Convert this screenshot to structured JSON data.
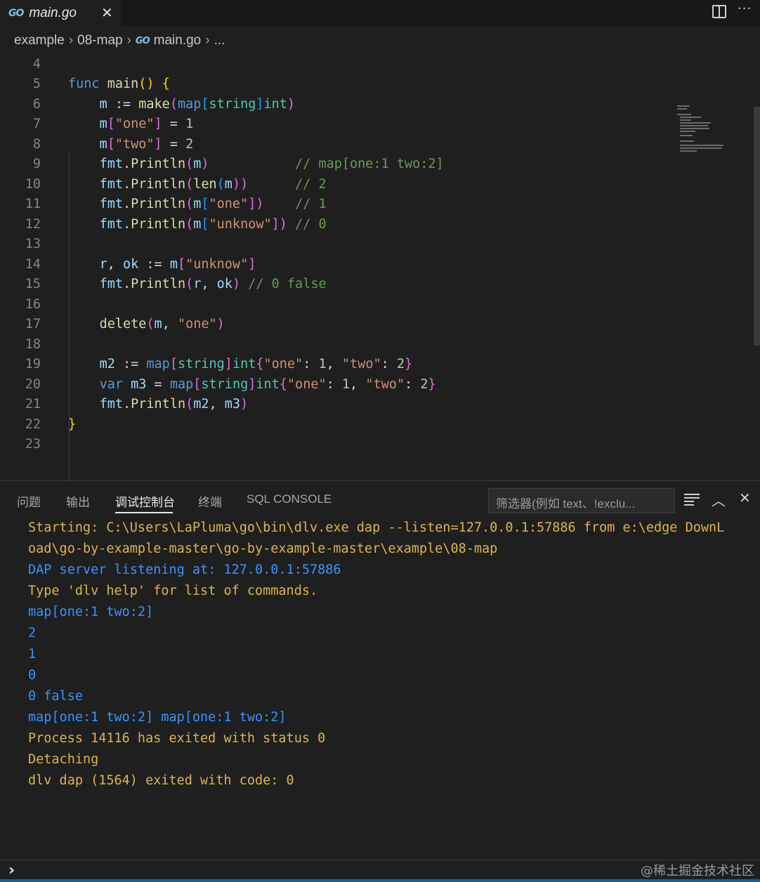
{
  "tab": {
    "icon": "go-logo-icon",
    "logo_text": "GO",
    "title": "main.go",
    "close": "✕"
  },
  "toolbar": {
    "split": "split-editor-icon",
    "more": "···"
  },
  "breadcrumb": {
    "parts": [
      "example",
      "08-map",
      "main.go",
      "..."
    ]
  },
  "editor": {
    "lines": [
      {
        "n": "4"
      },
      {
        "n": "5"
      },
      {
        "n": "6"
      },
      {
        "n": "7"
      },
      {
        "n": "8"
      },
      {
        "n": "9"
      },
      {
        "n": "10"
      },
      {
        "n": "11"
      },
      {
        "n": "12"
      },
      {
        "n": "13"
      },
      {
        "n": "14"
      },
      {
        "n": "15"
      },
      {
        "n": "16"
      },
      {
        "n": "17"
      },
      {
        "n": "18"
      },
      {
        "n": "19"
      },
      {
        "n": "20"
      },
      {
        "n": "21"
      },
      {
        "n": "22"
      },
      {
        "n": "23"
      }
    ],
    "code": {
      "l5": [
        "func",
        "main",
        "()",
        " {"
      ],
      "l6": [
        "m",
        ":=",
        "make",
        "(",
        "map",
        "[",
        "string",
        "]",
        "int",
        ")"
      ],
      "l7": [
        "m",
        "[",
        "\"one\"",
        "]",
        "=",
        "1"
      ],
      "l8": [
        "m",
        "[",
        "\"two\"",
        "]",
        "=",
        "2"
      ],
      "l9": [
        "fmt",
        ".",
        "Println",
        "(",
        "m",
        ")",
        "// map[one:1 two:2]"
      ],
      "l10": [
        "fmt",
        ".",
        "Println",
        "(",
        "len",
        "(",
        "m",
        "))",
        "// 2"
      ],
      "l11": [
        "fmt",
        ".",
        "Println",
        "(",
        "m",
        "[",
        "\"one\"",
        "])",
        "// 1"
      ],
      "l12": [
        "fmt",
        ".",
        "Println",
        "(",
        "m",
        "[",
        "\"unknow\"",
        "])",
        "// 0"
      ],
      "l14": [
        "r",
        ",",
        "ok",
        ":=",
        "m",
        "[",
        "\"unknow\"",
        "]"
      ],
      "l15": [
        "fmt",
        ".",
        "Println",
        "(",
        "r",
        ",",
        "ok",
        ")",
        "// 0 false"
      ],
      "l17": [
        "delete",
        "(",
        "m",
        ",",
        "\"one\"",
        ")"
      ],
      "l19": [
        "m2",
        ":=",
        "map",
        "[",
        "string",
        "]",
        "int",
        "{",
        "\"one\"",
        ":",
        "1",
        ",",
        "\"two\"",
        ":",
        "2",
        "}"
      ],
      "l20": [
        "var",
        "m3",
        "=",
        "map",
        "[",
        "string",
        "]",
        "int",
        "{",
        "\"one\"",
        ":",
        "1",
        ",",
        "\"two\"",
        ":",
        "2",
        "}"
      ],
      "l21": [
        "fmt",
        ".",
        "Println",
        "(",
        "m2",
        ",",
        "m3",
        ")"
      ],
      "l22": [
        "}"
      ]
    }
  },
  "panel": {
    "tabs": [
      "问题",
      "输出",
      "调试控制台",
      "终端",
      "SQL CONSOLE"
    ],
    "active_tab": "调试控制台",
    "filter_placeholder": "筛选器(例如 text、!exclu...",
    "output": [
      {
        "text": "Starting: C:\\Users\\LaPluma\\go\\bin\\dlv.exe dap --listen=127.0.0.1:57886 from e:\\edge DownL",
        "color": "yellow"
      },
      {
        "text": "oad\\go-by-example-master\\go-by-example-master\\example\\08-map",
        "color": "yellow"
      },
      {
        "text": "DAP server listening at: 127.0.0.1:57886",
        "color": "blue"
      },
      {
        "text": "Type 'dlv help' for list of commands.",
        "color": "yellow"
      },
      {
        "text": "map[one:1 two:2]",
        "color": "blue"
      },
      {
        "text": "2",
        "color": "blue"
      },
      {
        "text": "1",
        "color": "blue"
      },
      {
        "text": "0",
        "color": "blue"
      },
      {
        "text": "0 false",
        "color": "blue"
      },
      {
        "text": "map[one:1 two:2] map[one:1 two:2]",
        "color": "blue"
      },
      {
        "text": "Process 14116 has exited with status 0",
        "color": "yellow"
      },
      {
        "text": "Detaching",
        "color": "yellow"
      },
      {
        "text": "dlv dap (1564) exited with code: 0",
        "color": "yellow"
      }
    ]
  },
  "input": {
    "prompt": "›"
  },
  "watermark": "@稀土掘金技术社区",
  "colors": {
    "accent": "#0e639c",
    "console_yellow": "#dcb54c",
    "console_blue": "#3794ff"
  }
}
